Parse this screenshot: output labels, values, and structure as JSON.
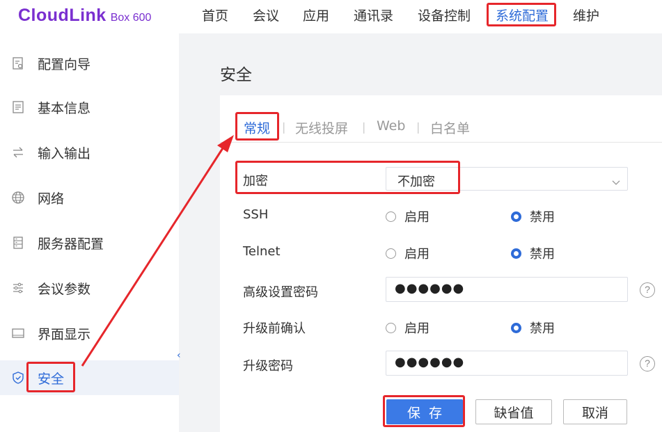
{
  "header": {
    "logo_main": "CloudLink",
    "logo_sub": "Box 600",
    "nav": [
      {
        "label": "首页"
      },
      {
        "label": "会议"
      },
      {
        "label": "应用"
      },
      {
        "label": "通讯录"
      },
      {
        "label": "设备控制"
      },
      {
        "label": "系统配置",
        "active": true
      },
      {
        "label": "维护"
      }
    ]
  },
  "sidebar": {
    "items": [
      {
        "label": "配置向导",
        "icon": "wizard-icon"
      },
      {
        "label": "基本信息",
        "icon": "document-icon"
      },
      {
        "label": "输入输出",
        "icon": "swap-arrows-icon"
      },
      {
        "label": "网络",
        "icon": "globe-icon"
      },
      {
        "label": "服务器配置",
        "icon": "server-icon"
      },
      {
        "label": "会议参数",
        "icon": "sliders-icon"
      },
      {
        "label": "界面显示",
        "icon": "display-icon"
      },
      {
        "label": "安全",
        "icon": "shield-icon",
        "active": true
      }
    ],
    "collapse_glyph": "‹"
  },
  "main": {
    "title": "安全",
    "tabs": [
      {
        "label": "常规",
        "active": true
      },
      {
        "label": "无线投屏"
      },
      {
        "label": "Web"
      },
      {
        "label": "白名单"
      }
    ],
    "tab_separator": "|",
    "form": {
      "encryption": {
        "label": "加密",
        "value": "不加密"
      },
      "ssh": {
        "label": "SSH",
        "options": [
          "启用",
          "禁用"
        ],
        "selected": "禁用"
      },
      "telnet": {
        "label": "Telnet",
        "options": [
          "启用",
          "禁用"
        ],
        "selected": "禁用"
      },
      "advanced_password": {
        "label": "高级设置密码",
        "value": "●●●●●●",
        "help": "?"
      },
      "upgrade_confirm": {
        "label": "升级前确认",
        "options": [
          "启用",
          "禁用"
        ],
        "selected": "禁用"
      },
      "upgrade_password": {
        "label": "升级密码",
        "value": "●●●●●●",
        "help": "?"
      }
    },
    "buttons": {
      "save": "保存",
      "default": "缺省值",
      "cancel": "取消"
    }
  },
  "colors": {
    "accent": "#2e6bd8",
    "brand": "#7a2fd0",
    "annotation": "#e6262b"
  }
}
